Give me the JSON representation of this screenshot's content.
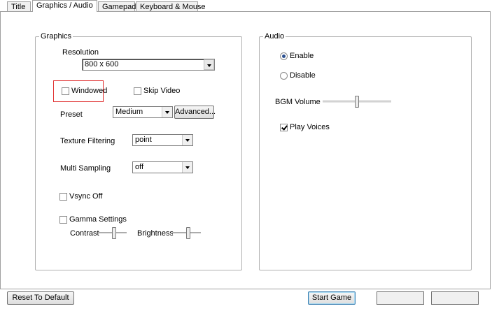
{
  "tabs": [
    {
      "label": "Title"
    },
    {
      "label": "Graphics / Audio",
      "active": true
    },
    {
      "label": "Gamepad"
    },
    {
      "label": "Keyboard & Mouse"
    }
  ],
  "graphics": {
    "group_label": "Graphics",
    "resolution_label": "Resolution",
    "resolution_value": "800  x  600",
    "windowed_label": "Windowed",
    "windowed_checked": false,
    "skip_video_label": "Skip Video",
    "skip_video_checked": false,
    "preset_label": "Preset",
    "preset_value": "Medium",
    "advanced_button": "Advanced...",
    "texture_filtering_label": "Texture Filtering",
    "texture_filtering_value": "point",
    "multi_sampling_label": "Multi Sampling",
    "multi_sampling_value": "off",
    "vsync_label": "Vsync Off",
    "vsync_checked": false,
    "gamma_label": "Gamma Settings",
    "gamma_checked": false,
    "contrast_label": "Contrast",
    "contrast_level": 0.55,
    "brightness_label": "Brightness",
    "brightness_level": 0.55
  },
  "audio": {
    "group_label": "Audio",
    "enable_label": "Enable",
    "enable_selected": true,
    "disable_label": "Disable",
    "bgm_volume_label": "BGM Volume",
    "bgm_volume_level": 0.5,
    "play_voices_label": "Play Voices",
    "play_voices_checked": true
  },
  "footer": {
    "reset_button": "Reset To Default",
    "start_button": "Start Game"
  },
  "colors": {
    "highlight": "#e03030",
    "radio_dot": "#2b4f8f"
  }
}
